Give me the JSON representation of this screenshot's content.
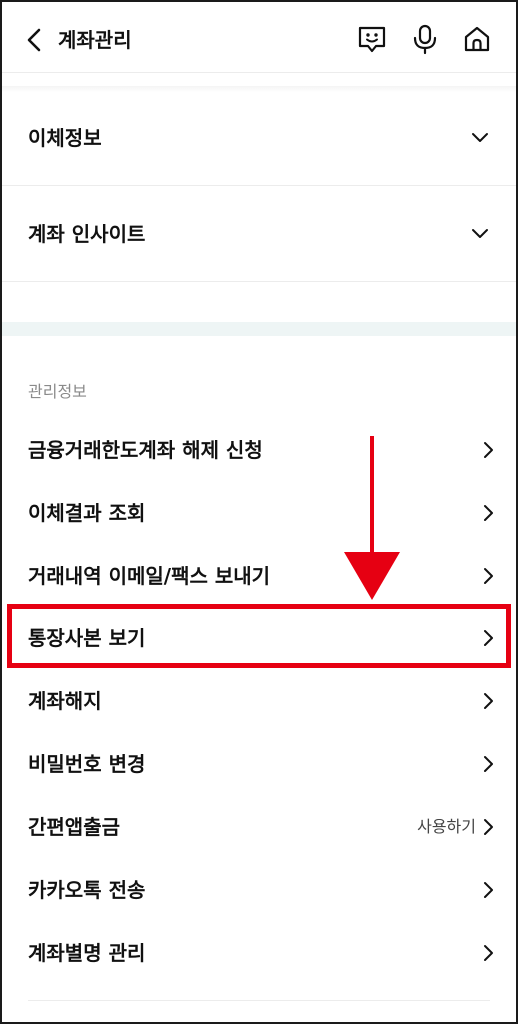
{
  "header": {
    "title": "계좌관리",
    "icons": [
      "back-chevron-icon",
      "chat-bot-icon",
      "microphone-icon",
      "home-icon"
    ]
  },
  "accordions": [
    {
      "label": "이체정보"
    },
    {
      "label": "계좌 인사이트"
    }
  ],
  "section": {
    "label": "관리정보"
  },
  "menu": [
    {
      "label": "금융거래한도계좌 해제 신청",
      "extra": ""
    },
    {
      "label": "이체결과 조회",
      "extra": ""
    },
    {
      "label": "거래내역 이메일/팩스 보내기",
      "extra": ""
    },
    {
      "label": "통장사본 보기",
      "extra": "",
      "highlighted": true
    },
    {
      "label": "계좌해지",
      "extra": ""
    },
    {
      "label": "비밀번호 변경",
      "extra": ""
    },
    {
      "label": "간편앱출금",
      "extra": "사용하기"
    },
    {
      "label": "카카오톡 전송",
      "extra": ""
    },
    {
      "label": "계좌별명 관리",
      "extra": ""
    }
  ],
  "annotation": {
    "color": "#e60012"
  }
}
